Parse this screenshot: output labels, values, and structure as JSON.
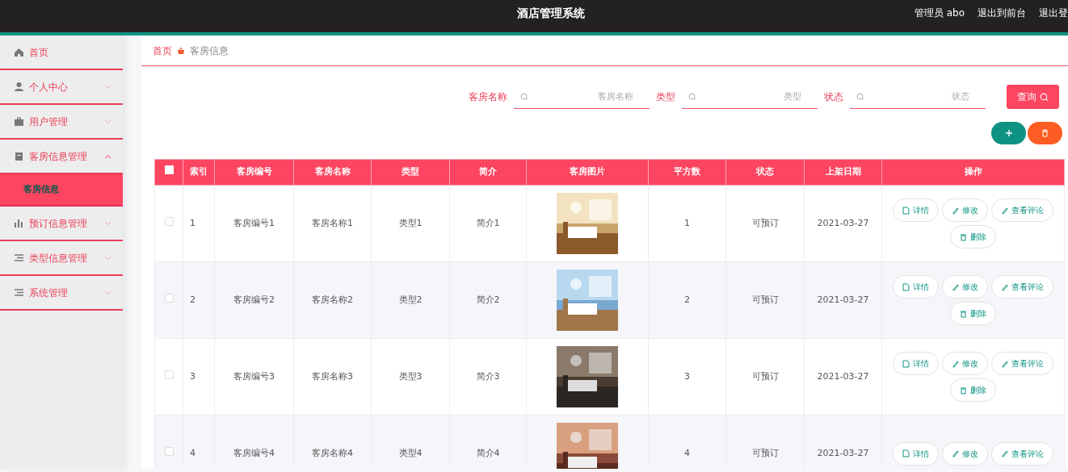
{
  "header": {
    "title": "酒店管理系统",
    "links": [
      "管理员 abo",
      "退出到前台",
      "退出登"
    ]
  },
  "sidebar": {
    "items": [
      {
        "label": "首页"
      },
      {
        "label": "个人中心",
        "expanded": false
      },
      {
        "label": "用户管理",
        "expanded": false
      },
      {
        "label": "客房信息管理",
        "expanded": true,
        "children": [
          {
            "label": "客房信息",
            "selected": true
          }
        ]
      },
      {
        "label": "预订信息管理",
        "expanded": false
      },
      {
        "label": "类型信息管理",
        "expanded": false
      },
      {
        "label": "系统管理",
        "expanded": false
      }
    ]
  },
  "breadcrumb": [
    "首页",
    "客房信息"
  ],
  "search": {
    "fields": [
      {
        "label": "客房名称",
        "placeholder": "客房名称"
      },
      {
        "label": "类型",
        "placeholder": "类型"
      },
      {
        "label": "状态",
        "placeholder": "状态"
      }
    ],
    "button": "查询"
  },
  "table": {
    "select_all": {
      "checked": false
    },
    "columns": [
      "索引",
      "客房编号",
      "客房名称",
      "类型",
      "简介",
      "客房图片",
      "平方数",
      "状态",
      "上架日期",
      "操作"
    ],
    "rows": [
      {
        "checked": false,
        "cells": [
          "1",
          "客房编号1",
          "客房名称1",
          "类型1",
          "简介1",
          {
            "kind": "picture"
          },
          "1",
          "可预订",
          "2021-03-27"
        ],
        "actions": [
          "详情",
          "修改",
          "查看评论",
          "删除"
        ]
      },
      {
        "checked": false,
        "cells": [
          "2",
          "客房编号2",
          "客房名称2",
          "类型2",
          "简介2",
          {
            "kind": "picture"
          },
          "2",
          "可预订",
          "2021-03-27"
        ],
        "actions": [
          "详情",
          "修改",
          "查看评论",
          "删除"
        ]
      },
      {
        "checked": false,
        "cells": [
          "3",
          "客房编号3",
          "客房名称3",
          "类型3",
          "简介3",
          {
            "kind": "picture"
          },
          "3",
          "可预订",
          "2021-03-27"
        ],
        "actions": [
          "详情",
          "修改",
          "查看评论",
          "删除"
        ]
      },
      {
        "checked": false,
        "cells": [
          "4",
          "客房编号4",
          "客房名称4",
          "类型4",
          "简介4",
          {
            "kind": "picture"
          },
          "4",
          "可预订",
          "2021-03-27"
        ],
        "actions": [
          "详情",
          "修改",
          "查看评论"
        ]
      }
    ]
  }
}
